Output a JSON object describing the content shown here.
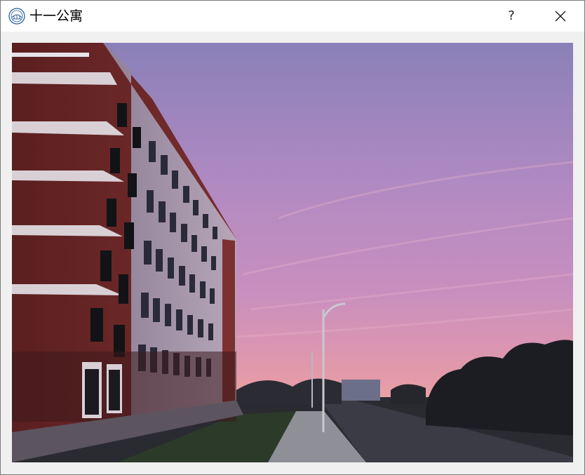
{
  "window": {
    "title": "十一公寓",
    "help_label": "?",
    "close_icon": "close-icon",
    "app_icon": "university-seal-icon"
  },
  "photo": {
    "description_icon": "photo-dormitory-sunset",
    "colors": {
      "sky_top": "#8a80b8",
      "sky_mid": "#c08ac0",
      "sky_horizon": "#e99aa6",
      "building": "#6e2a2a",
      "building_stripe": "#d9d0d6",
      "trees": "#1e1f24",
      "road": "#3a3b44"
    }
  }
}
